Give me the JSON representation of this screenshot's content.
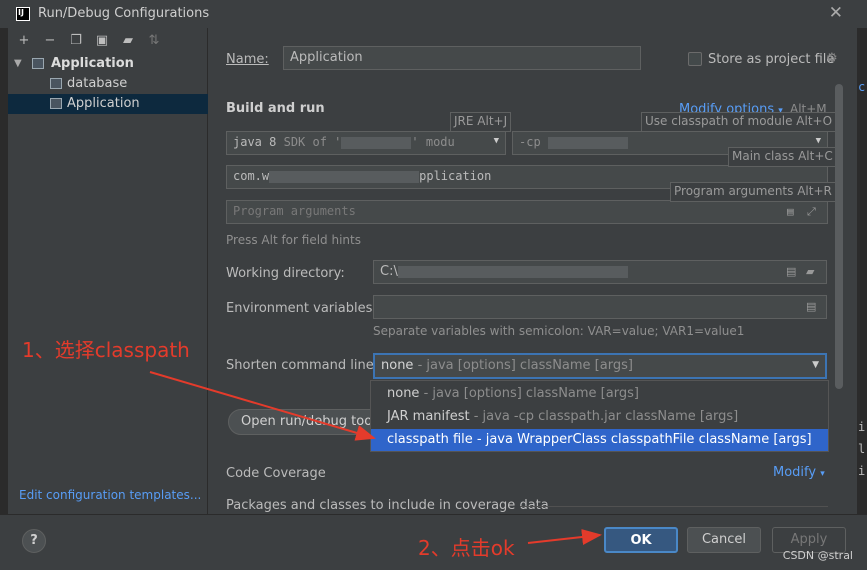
{
  "window": {
    "title": "Run/Debug Configurations",
    "logo_text": "IJ"
  },
  "sidebar": {
    "toolbar": [
      "add-icon",
      "remove-icon",
      "copy-icon",
      "save-icon",
      "folder-icon",
      "sort-icon"
    ],
    "tree": [
      {
        "label": "Application",
        "level": 0,
        "bold": true
      },
      {
        "label": "database",
        "level": 1
      },
      {
        "label": "Application",
        "level": 1,
        "selected": true
      }
    ],
    "edit_templates_link": "Edit configuration templates..."
  },
  "form": {
    "name_label": "Name:",
    "name_value": "Application",
    "store_label": "Store as project file",
    "build_run_title": "Build and run",
    "modify_options": "Modify options",
    "modify_shortcut": "Alt+M",
    "jre_tooltip": "JRE Alt+J",
    "classpath_tooltip": "Use classpath of module Alt+O",
    "main_class_tooltip": "Main class Alt+C",
    "program_args_tooltip": "Program arguments Alt+R",
    "jre_value_prefix": "java 8",
    "jre_value_suffix": "SDK of '",
    "jre_value_end": "' modu",
    "module_prefix": "-cp",
    "main_class_prefix": "com.w",
    "main_class_suffix": "pplication",
    "program_args_placeholder": "Program arguments",
    "hint": "Press Alt for field hints",
    "working_dir_label": "Working directory:",
    "working_dir_value": "C:\\",
    "env_label": "Environment variables:",
    "env_hint": "Separate variables with semicolon: VAR=value; VAR1=value1",
    "shorten_label": "Shorten command line:",
    "shorten_selected": "none",
    "shorten_selected_desc": " - java [options] className [args]",
    "open_tool_window": "Open run/debug tool window",
    "code_coverage": "Code Coverage",
    "modify": "Modify",
    "packages": "Packages and classes to include in coverage data"
  },
  "dropdown_options": [
    {
      "name": "none",
      "desc": " - java [options] className [args]"
    },
    {
      "name": "JAR manifest",
      "desc": " - java -cp classpath.jar className [args]"
    },
    {
      "name": "classpath file",
      "desc": " - java WrapperClass classpathFile className [args]",
      "selected": true
    }
  ],
  "buttons": {
    "help": "?",
    "ok": "OK",
    "cancel": "Cancel",
    "apply": "Apply"
  },
  "annotations": {
    "step1": "1、选择classpath",
    "step2": "2、点击ok"
  },
  "watermark": "CSDN @stral",
  "background_chars": [
    "c",
    "i",
    "l",
    "i"
  ]
}
